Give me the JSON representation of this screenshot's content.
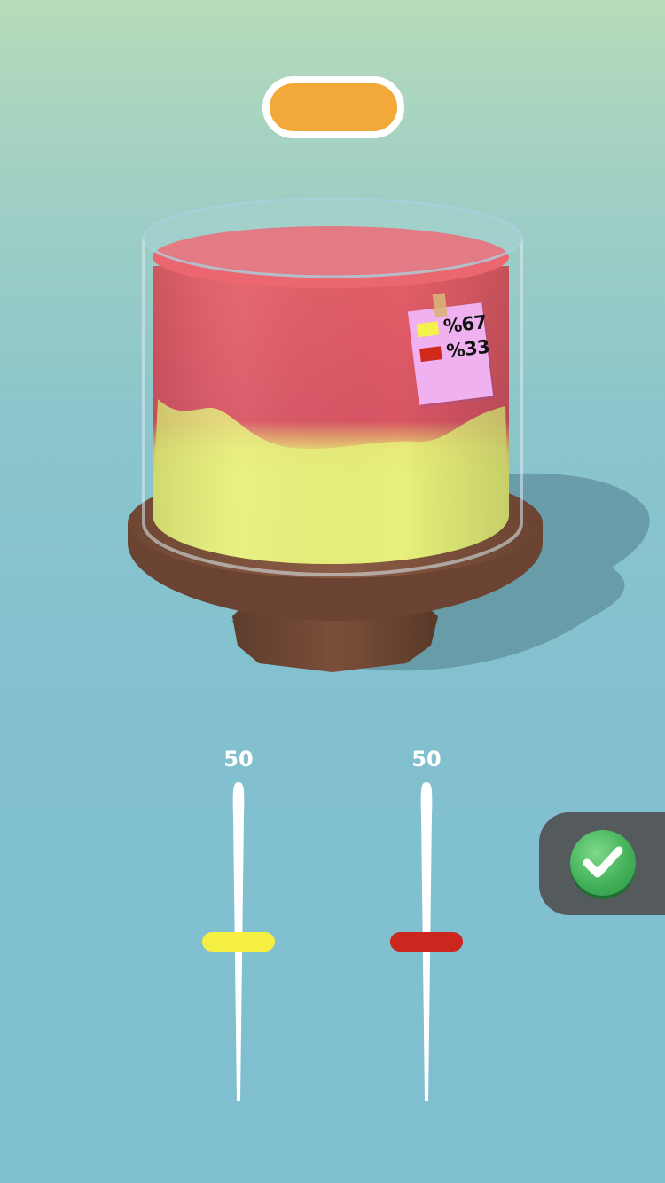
{
  "top_pill": {
    "color": "#f3a93a"
  },
  "cake": {
    "top_color": "#e05860",
    "bottom_color": "#e8f07a",
    "stand_color": "#7a4f3a"
  },
  "note": {
    "rows": [
      {
        "swatch_color": "#f4f14a",
        "text": "%67"
      },
      {
        "swatch_color": "#d0281c",
        "text": "%33"
      }
    ]
  },
  "sliders": [
    {
      "value_label": "50",
      "level": 0.5,
      "thumb_color": "#f5ef43"
    },
    {
      "value_label": "50",
      "level": 0.5,
      "thumb_color": "#cd261f"
    }
  ],
  "confirm": {
    "icon": "check-icon",
    "color": "#43b25a"
  }
}
